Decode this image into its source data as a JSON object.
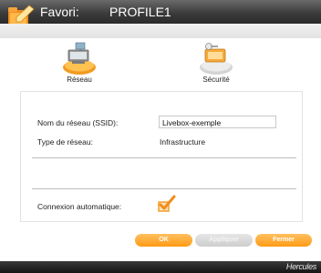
{
  "window": {
    "title": "Favori:",
    "profile_name": "PROFILE1"
  },
  "tabs": {
    "network_label": "Réseau",
    "security_label": "Sécurité"
  },
  "network": {
    "ssid_label": "Nom du réseau (SSID):",
    "ssid_value": "Livebox-exemple",
    "type_label": "Type de réseau:",
    "type_value": "Infrastructure",
    "auto_connect_label": "Connexion automatique:",
    "auto_connect_checked": true
  },
  "buttons": {
    "ok": "OK",
    "apply": "Appliquer",
    "close": "Fermer"
  },
  "footer": {
    "brand": "Hercules"
  },
  "colors": {
    "accent": "#ff9b14",
    "titlebar": "#3c3c3c",
    "disabled_button": "#d4d4d4"
  },
  "icons": {
    "title": "favorite-folder-icon",
    "network": "network-computer-icon",
    "security": "security-key-icon",
    "checkbox": "checkmark-icon"
  }
}
